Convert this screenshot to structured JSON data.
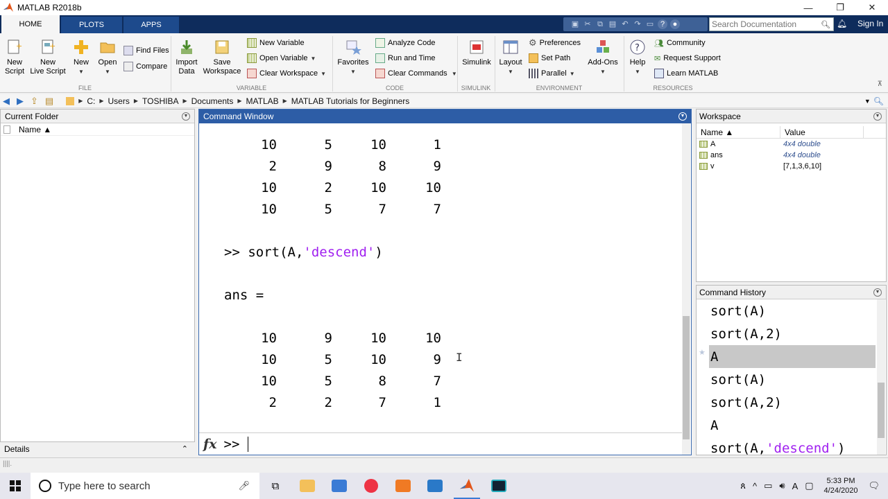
{
  "window": {
    "title": "MATLAB R2018b",
    "minimize": "—",
    "restore": "❐",
    "close": "✕"
  },
  "tabs": {
    "home": "HOME",
    "plots": "PLOTS",
    "apps": "APPS"
  },
  "search": {
    "placeholder": "Search Documentation"
  },
  "signin": "Sign In",
  "ribbon": {
    "new_script": "New\nScript",
    "new_script_1": "New",
    "new_script_2": "Script",
    "new_live_1": "New",
    "new_live_2": "Live Script",
    "new": "New",
    "open": "Open",
    "find_files": "Find Files",
    "compare": "Compare",
    "import_1": "Import",
    "import_2": "Data",
    "save_1": "Save",
    "save_2": "Workspace",
    "new_variable": "New Variable",
    "open_variable": "Open Variable",
    "clear_workspace": "Clear Workspace",
    "favorites": "Favorites",
    "analyze_code": "Analyze Code",
    "run_and_time": "Run and Time",
    "clear_commands": "Clear Commands",
    "simulink": "Simulink",
    "layout": "Layout",
    "preferences": "Preferences",
    "set_path": "Set Path",
    "parallel": "Parallel",
    "addons": "Add-Ons",
    "help": "Help",
    "community": "Community",
    "request_support": "Request Support",
    "learn_matlab": "Learn MATLAB",
    "sections": {
      "file": "FILE",
      "variable": "VARIABLE",
      "code": "CODE",
      "simulink": "SIMULINK",
      "environment": "ENVIRONMENT",
      "resources": "RESOURCES"
    }
  },
  "address": {
    "crumbs": [
      "C:",
      "Users",
      "TOSHIBA",
      "Documents",
      "MATLAB",
      "MATLAB Tutorials for Beginners"
    ]
  },
  "current_folder": {
    "title": "Current Folder",
    "col_name": "Name ▲",
    "details": "Details"
  },
  "command_window": {
    "title": "Command Window",
    "prev_matrix": [
      [
        "10",
        "5",
        "10",
        "1"
      ],
      [
        "2",
        "9",
        "8",
        "9"
      ],
      [
        "10",
        "2",
        "10",
        "10"
      ],
      [
        "10",
        "5",
        "7",
        "7"
      ]
    ],
    "cmd_prefix": ">> sort(A,",
    "cmd_arg": "'descend'",
    "cmd_suffix": ")",
    "ans_label": "ans =",
    "ans_matrix": [
      [
        "10",
        "9",
        "10",
        "10"
      ],
      [
        "10",
        "5",
        "10",
        "9"
      ],
      [
        "10",
        "5",
        "8",
        "7"
      ],
      [
        "2",
        "2",
        "7",
        "1"
      ]
    ],
    "fx": "fx",
    "prompt": ">>"
  },
  "workspace": {
    "title": "Workspace",
    "col_name": "Name ▲",
    "col_value": "Value",
    "vars": [
      {
        "name": "A",
        "value": "4x4 double"
      },
      {
        "name": "ans",
        "value": "4x4 double"
      },
      {
        "name": "v",
        "value": "[7,1,3,6,10]"
      }
    ]
  },
  "history": {
    "title": "Command History",
    "items": [
      "sort(A)",
      "sort(A,2)",
      "A",
      "sort(A)",
      "sort(A,2)",
      "A"
    ],
    "last_prefix": "sort(A,",
    "last_arg": "'descend'",
    "last_suffix": ")"
  },
  "taskbar": {
    "search_placeholder": "Type here to search",
    "time": "5:33 PM",
    "date": "4/24/2020"
  },
  "colors": {
    "accent": "#0e2c5c",
    "cmd_header": "#2d5da6",
    "string": "#a020f0"
  }
}
